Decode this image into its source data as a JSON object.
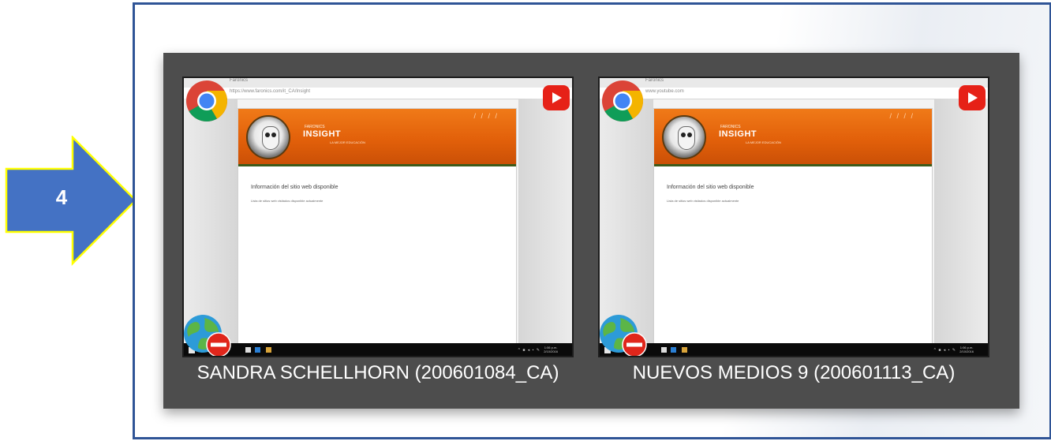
{
  "step": {
    "number": "4"
  },
  "colors": {
    "arrow_fill": "#4472c4",
    "arrow_outline": "#ffff00",
    "frame_border": "#2f5496",
    "panel_bg": "#4d4d4d",
    "header_orange": "#e2600a"
  },
  "tiles": [
    {
      "caption": "SANDRA SCHELLHORN (200601084_CA)",
      "tab": "Faronics",
      "url": "https://www.faronics.com/it_CA/Insight",
      "brand_small": "FARONICS",
      "brand": "INSIGHT",
      "brand_tag": "LA MEJOR EDUCACIÓN",
      "heading": "Información del sitio web disponible",
      "subtext": "Lista de sitios web visitados disponible actualmente",
      "clock_time": "1:06 p.m.",
      "clock_date": "2/10/2016",
      "icons": [
        "chrome-icon",
        "youtube-icon",
        "globe-icon",
        "blocked-icon"
      ]
    },
    {
      "caption": "NUEVOS MEDIOS 9 (200601113_CA)",
      "tab": "Faronics",
      "url": "www.youtube.com",
      "brand_small": "FARONICS",
      "brand": "INSIGHT",
      "brand_tag": "LA MEJOR EDUCACIÓN",
      "heading": "Información del sitio web disponible",
      "subtext": "Lista de sitios web visitados disponible actualmente",
      "clock_time": "1:06 p.m.",
      "clock_date": "2/10/2016",
      "icons": [
        "chrome-icon",
        "youtube-icon",
        "globe-icon",
        "blocked-icon"
      ]
    }
  ]
}
